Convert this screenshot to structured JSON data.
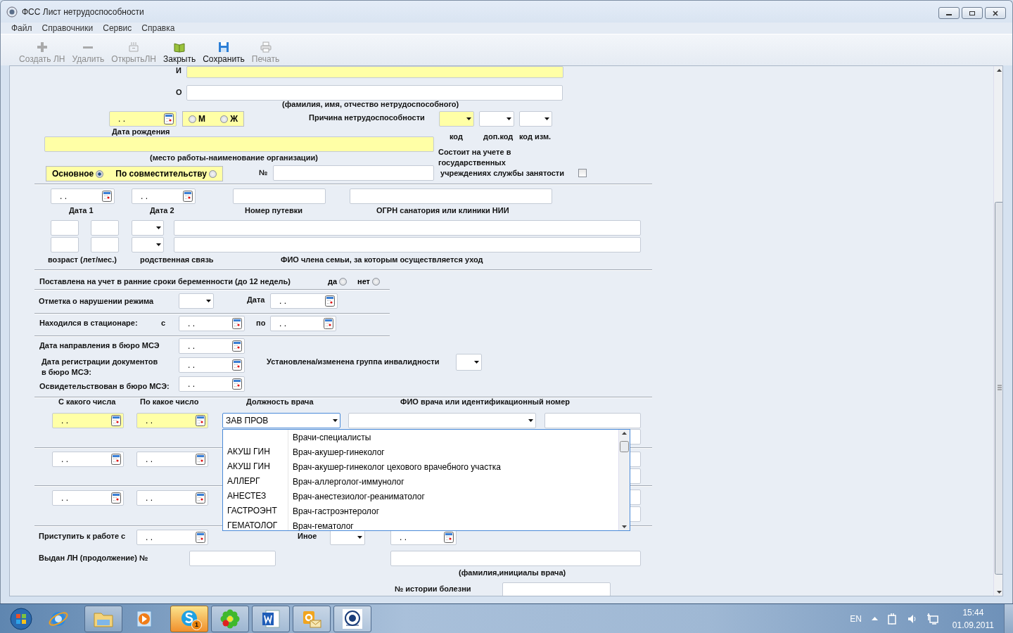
{
  "window": {
    "title": "ФСС Лист нетрудоспособности"
  },
  "menu": [
    "Файл",
    "Справочники",
    "Сервис",
    "Справка"
  ],
  "toolbar": [
    {
      "kind": "create",
      "label": "Создать ЛН",
      "disabled": true
    },
    {
      "kind": "delete",
      "label": "Удалить",
      "disabled": true
    },
    {
      "kind": "open",
      "label": "ОткрытьЛН",
      "disabled": true
    },
    {
      "kind": "close",
      "label": "Закрыть",
      "disabled": false
    },
    {
      "kind": "save",
      "label": "Сохранить",
      "disabled": false
    },
    {
      "kind": "print",
      "label": "Печать",
      "disabled": true
    }
  ],
  "form": {
    "items": [
      {
        "kind": "label",
        "text": "И"
      },
      {
        "kind": "field",
        "required": true
      },
      {
        "kind": "label",
        "text": "О"
      },
      {
        "kind": "field",
        "required": false
      },
      {
        "kind": "label",
        "text": "(фамилия, имя, отчество нетрудоспособного)"
      },
      {
        "kind": "date",
        "value": ". .",
        "required": true
      },
      {
        "kind": "radios",
        "required": true,
        "options": [
          {
            "label": "М",
            "selected": false
          },
          {
            "label": "Ж",
            "selected": false
          }
        ]
      },
      {
        "kind": "label",
        "text": "Дата рождения"
      },
      {
        "kind": "label",
        "text": "Причина нетрудоспособности"
      },
      {
        "kind": "combo",
        "required": true
      },
      {
        "kind": "combo",
        "required": false
      },
      {
        "kind": "combo",
        "required": false
      },
      {
        "kind": "label",
        "text": "код"
      },
      {
        "kind": "label",
        "text": "доп.код"
      },
      {
        "kind": "label",
        "text": "код изм."
      },
      {
        "kind": "field",
        "required": true
      },
      {
        "kind": "label",
        "text": "(место работы-наименование организации)"
      },
      {
        "kind": "radios",
        "required": true,
        "options": [
          {
            "label": "Основное",
            "selected": true
          },
          {
            "label": "По совместительству",
            "selected": false
          }
        ]
      },
      {
        "kind": "label",
        "text": "№"
      },
      {
        "kind": "field",
        "required": false
      },
      {
        "kind": "label",
        "text": "Состоит на учете в\nгосударственных\n учреждениях службы занятости"
      },
      {
        "kind": "checkbox",
        "checked": false
      },
      {
        "kind": "date",
        "value": ". .",
        "required": false
      },
      {
        "kind": "label",
        "text": "Дата 1"
      },
      {
        "kind": "date",
        "value": ". .",
        "required": false
      },
      {
        "kind": "label",
        "text": "Дата 2"
      },
      {
        "kind": "field",
        "required": false
      },
      {
        "kind": "label",
        "text": "Номер путевки"
      },
      {
        "kind": "field",
        "required": false
      },
      {
        "kind": "label",
        "text": "ОГРН санатория или клиники НИИ"
      },
      {
        "kind": "field",
        "required": false
      },
      {
        "kind": "field",
        "required": false
      },
      {
        "kind": "combo",
        "required": false
      },
      {
        "kind": "field",
        "required": false
      },
      {
        "kind": "field",
        "required": false
      },
      {
        "kind": "field",
        "required": false
      },
      {
        "kind": "combo",
        "required": false
      },
      {
        "kind": "field",
        "required": false
      },
      {
        "kind": "label",
        "text": "возраст (лет/мес.)"
      },
      {
        "kind": "label",
        "text": "родственная связь"
      },
      {
        "kind": "label",
        "text": "ФИО члена семьи, за которым осуществляется уход"
      },
      {
        "kind": "label",
        "text": "Поставлена на учет в ранние сроки беременности (до 12 недель)"
      },
      {
        "kind": "radios",
        "options": [
          {
            "label": "да",
            "selected": false
          },
          {
            "label": "нет",
            "selected": false
          }
        ]
      },
      {
        "kind": "label",
        "text": "Отметка о нарушении режима"
      },
      {
        "kind": "combo",
        "required": false
      },
      {
        "kind": "label",
        "text": "Дата"
      },
      {
        "kind": "date",
        "value": ". .",
        "required": false
      },
      {
        "kind": "label",
        "text": "Находился в стационаре:"
      },
      {
        "kind": "label",
        "text": "с"
      },
      {
        "kind": "date",
        "value": ". .",
        "required": false
      },
      {
        "kind": "label",
        "text": "по"
      },
      {
        "kind": "date",
        "value": ". .",
        "required": false
      },
      {
        "kind": "label",
        "text": "Дата направления в бюро МСЭ"
      },
      {
        "kind": "date",
        "value": ". .",
        "required": false
      },
      {
        "kind": "label",
        "text": "Дата регистрации документов\nв бюро МСЭ:"
      },
      {
        "kind": "date",
        "value": ". .",
        "required": false
      },
      {
        "kind": "label",
        "text": "Освидетельствован в бюро МСЭ:"
      },
      {
        "kind": "date",
        "value": ". .",
        "required": false
      },
      {
        "kind": "label",
        "text": "Установлена/изменена группа инвалидности"
      },
      {
        "kind": "combo",
        "required": false
      },
      {
        "kind": "label",
        "text": "С какого числа"
      },
      {
        "kind": "label",
        "text": "По какое число"
      },
      {
        "kind": "label",
        "text": "Должность врача"
      },
      {
        "kind": "label",
        "text": "ФИО врача или идентификационный номер"
      },
      {
        "kind": "date",
        "value": ". .",
        "required": true
      },
      {
        "kind": "date",
        "value": ". .",
        "required": true
      },
      {
        "kind": "combo",
        "required": false,
        "value": "ЗАВ ПРОВ",
        "expanded": true,
        "options": [
          {
            "name": "Врачи-специалисты"
          },
          {
            "code": "АКУШ ГИН",
            "name": "Врач-акушер-гинеколог"
          },
          {
            "code": "АКУШ ГИН",
            "name": "Врач-акушер-гинеколог цехового врачебного участка"
          },
          {
            "code": "АЛЛЕРГ",
            "name": "Врач-аллерголог-иммунолог"
          },
          {
            "code": "АНЕСТЕЗ",
            "name": "Врач-анестезиолог-реаниматолог"
          },
          {
            "code": "ГАСТРОЭНТ",
            "name": "Врач-гастроэнтеролог"
          },
          {
            "code": "ГЕМАТОЛОГ",
            "name": "Врач-гематолог"
          }
        ]
      },
      {
        "kind": "combo",
        "required": false
      },
      {
        "kind": "field",
        "required": false
      },
      {
        "kind": "field",
        "required": false
      },
      {
        "kind": "date",
        "value": ". .",
        "required": false
      },
      {
        "kind": "date",
        "value": ". .",
        "required": false
      },
      {
        "kind": "field",
        "required": false
      },
      {
        "kind": "field",
        "required": false
      },
      {
        "kind": "date",
        "value": ". .",
        "required": false
      },
      {
        "kind": "date",
        "value": ". .",
        "required": false
      },
      {
        "kind": "field",
        "required": false
      },
      {
        "kind": "field",
        "required": false
      },
      {
        "kind": "label",
        "text": "Приступить к работе с"
      },
      {
        "kind": "date",
        "value": ". .",
        "required": false
      },
      {
        "kind": "label",
        "text": "Иное"
      },
      {
        "kind": "combo",
        "required": false
      },
      {
        "kind": "date",
        "value": ". .",
        "required": false
      },
      {
        "kind": "label",
        "text": "Выдан ЛН (продолжение) №"
      },
      {
        "kind": "field",
        "required": false
      },
      {
        "kind": "field",
        "required": false
      },
      {
        "kind": "label",
        "text": "(фамилия,инициалы врача)"
      },
      {
        "kind": "label",
        "text": "№ истории болезни"
      },
      {
        "kind": "field",
        "required": false
      }
    ]
  },
  "taskbar": {
    "apps": [
      {
        "kind": "start",
        "running": false,
        "active": false
      },
      {
        "kind": "browser",
        "running": false,
        "active": false
      },
      {
        "kind": "folder",
        "running": true,
        "active": false
      },
      {
        "kind": "player",
        "running": false,
        "active": false
      },
      {
        "kind": "chat",
        "running": true,
        "active": true,
        "badge": "1"
      },
      {
        "kind": "flower",
        "running": true,
        "active": false
      },
      {
        "kind": "document",
        "running": true,
        "active": false
      },
      {
        "kind": "mail",
        "running": true,
        "active": false
      },
      {
        "kind": "emblem",
        "running": true,
        "active": false
      }
    ],
    "language": "EN",
    "time": "15:44",
    "date": "01.09.2011"
  }
}
